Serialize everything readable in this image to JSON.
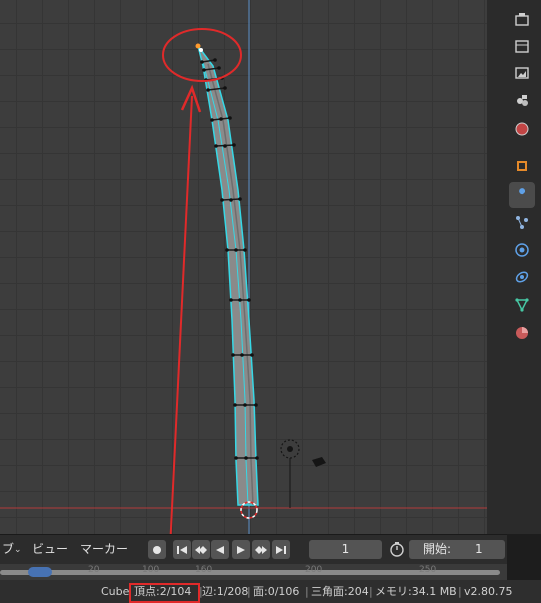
{
  "timeline": {
    "menu_partial": "ブ",
    "menu_view": "ビュー",
    "menu_marker": "マーカー",
    "current_frame": "1",
    "start_label": "開始:",
    "start_value": "1",
    "ruler_ticks": [
      "20",
      "100",
      "160",
      "200",
      "250"
    ]
  },
  "status": {
    "object": "Cube",
    "vertices": "頂点:2/104",
    "edges": "辺:1/208",
    "faces": "面:0/106",
    "tris": "三角面:204",
    "memory": "メモリ:34.1 MB",
    "version": "v2.80.75"
  },
  "colors": {
    "mesh_wire": "#36d8e6",
    "mesh_fill": "#8a8a8a",
    "annotation": "#e02a2a",
    "accent": "#4772b3"
  },
  "properties_tabs": [
    {
      "name": "tool-icon",
      "active": false
    },
    {
      "name": "render-icon",
      "active": false
    },
    {
      "name": "output-icon",
      "active": false
    },
    {
      "name": "view-layer-icon",
      "active": false
    },
    {
      "name": "scene-icon",
      "active": false
    },
    {
      "name": "world-icon",
      "active": false
    },
    {
      "name": "object-icon",
      "active": false
    },
    {
      "name": "modifier-wrench-icon",
      "active": true
    },
    {
      "name": "particles-icon",
      "active": false
    },
    {
      "name": "physics-icon",
      "active": false
    },
    {
      "name": "constraints-icon",
      "active": false
    },
    {
      "name": "object-data-icon",
      "active": false
    },
    {
      "name": "material-icon",
      "active": false
    }
  ]
}
